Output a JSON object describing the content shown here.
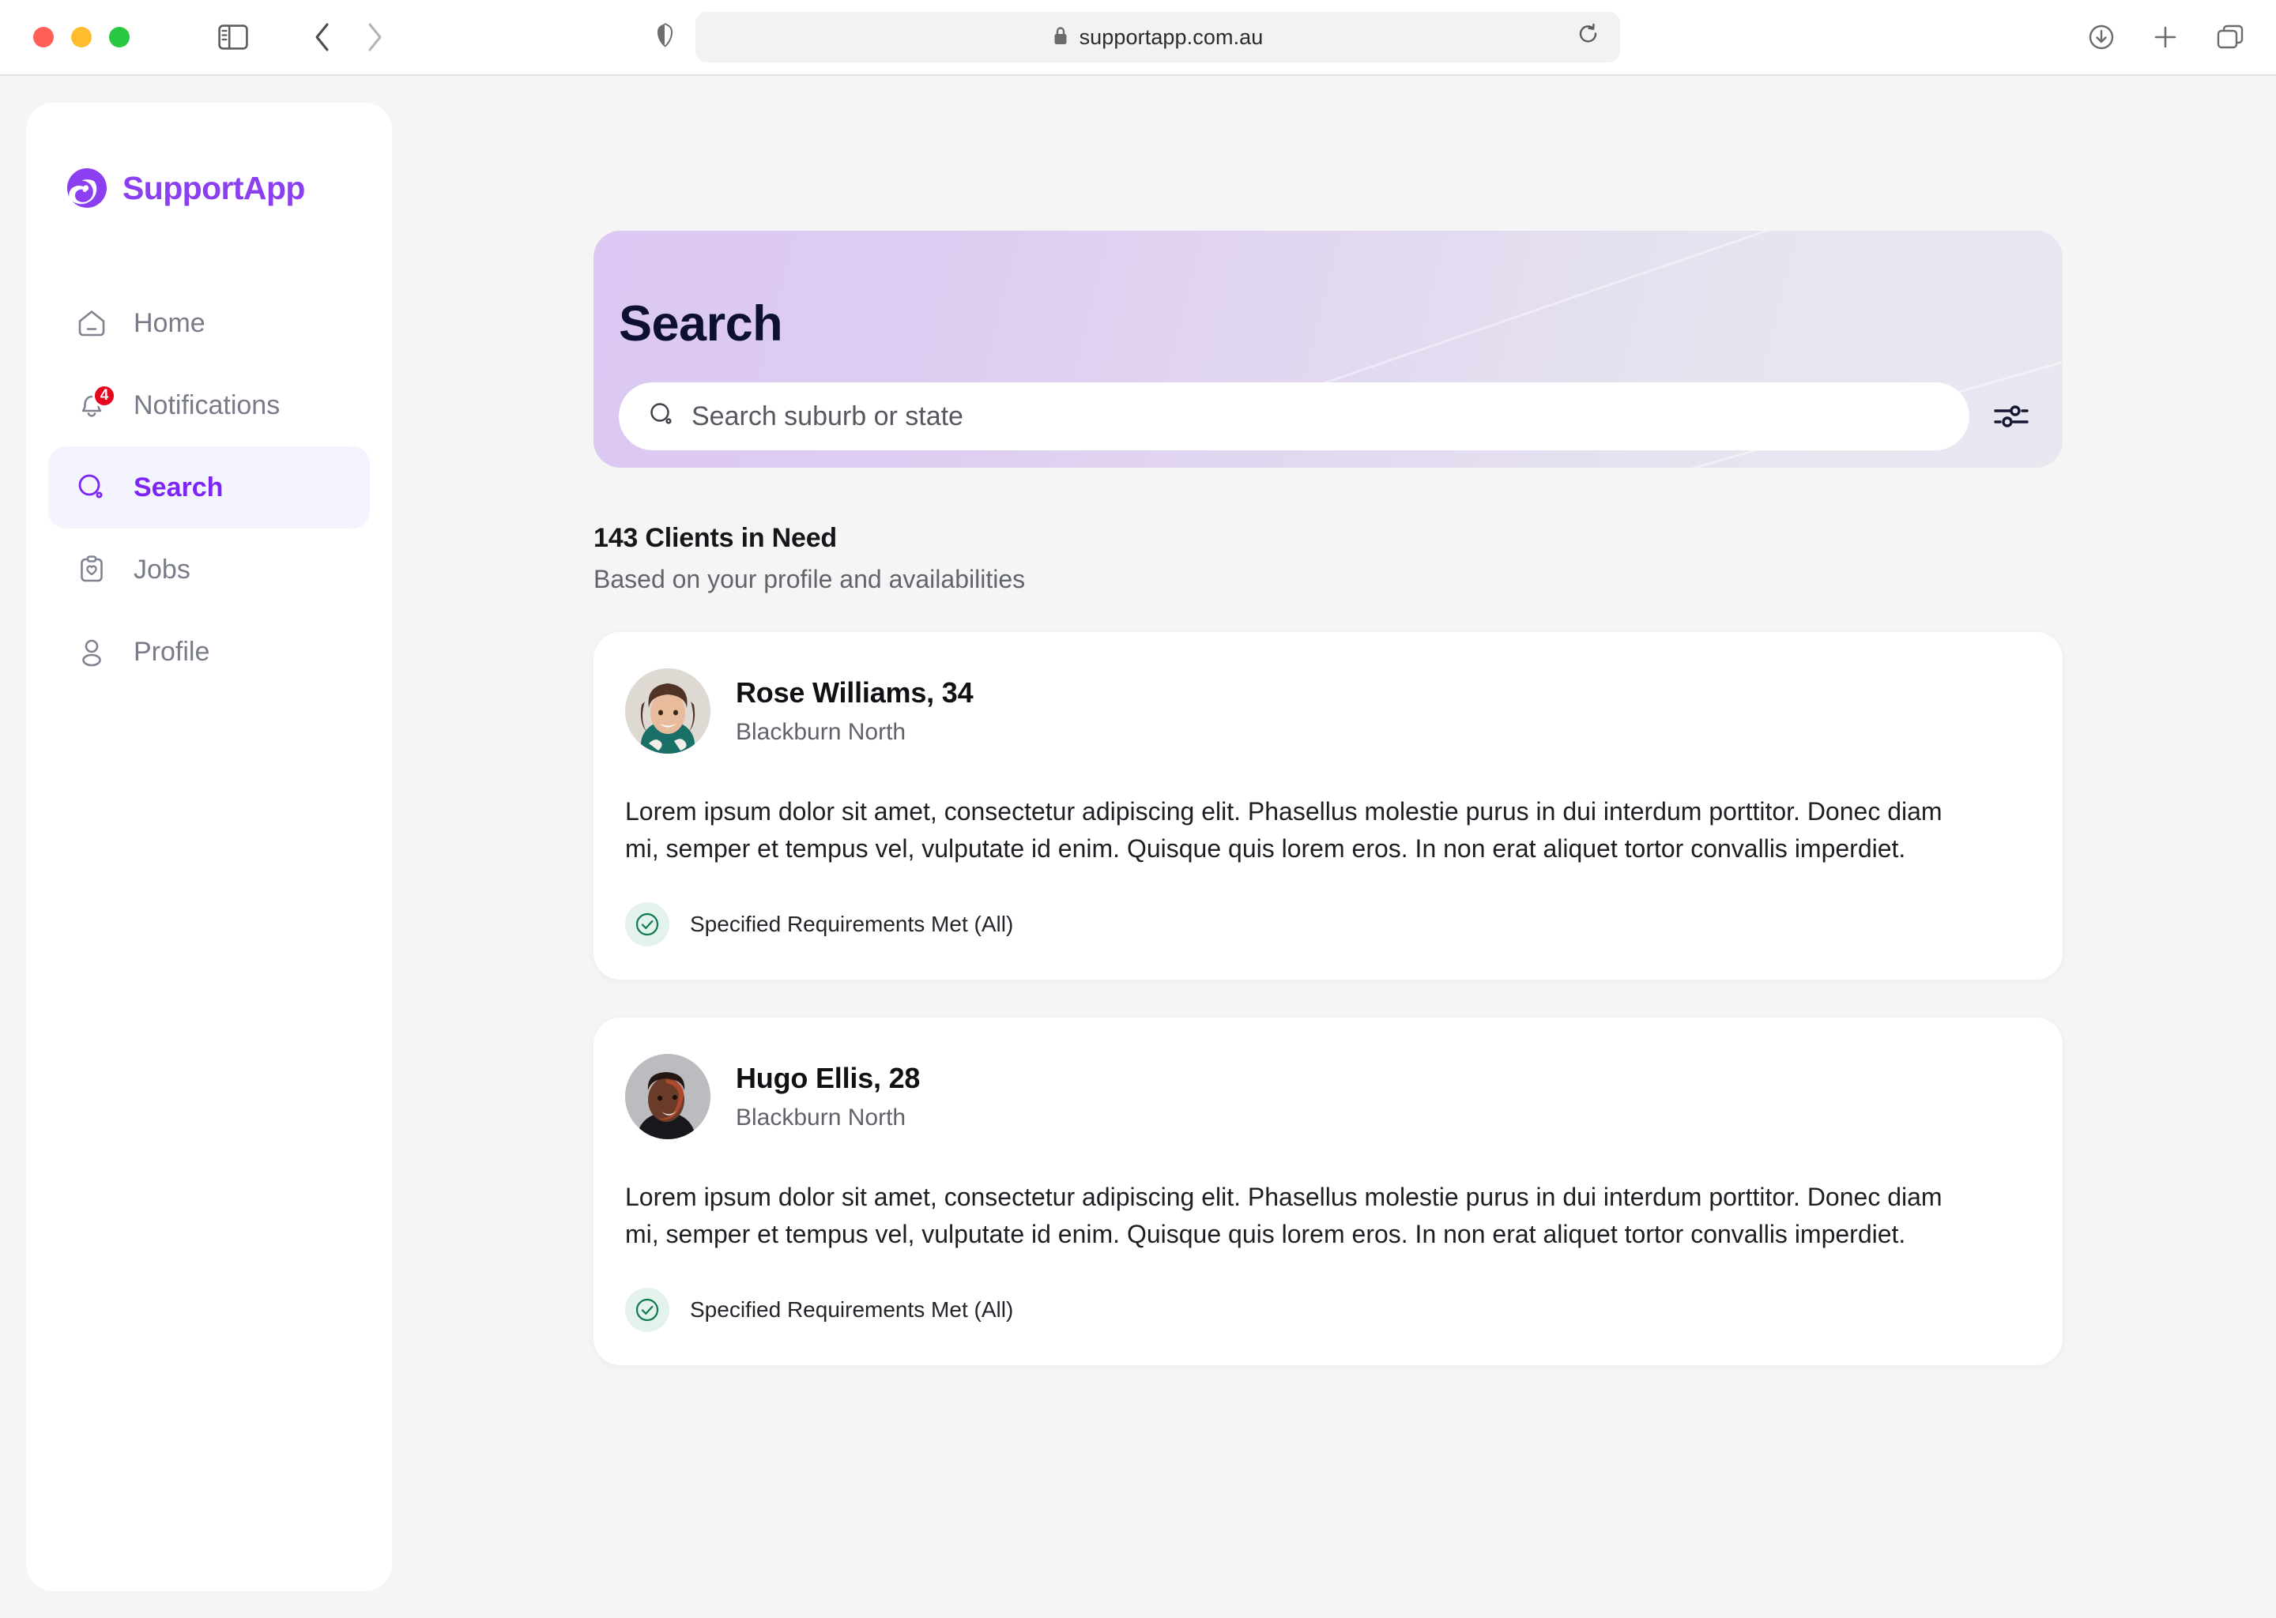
{
  "browser": {
    "url": "supportapp.com.au",
    "secure_icon": "lock-icon",
    "shield_icon": "shield-icon",
    "reload_icon": "reload-icon",
    "sidebar_toggle_icon": "sidebar-toggle-icon",
    "back_icon": "chevron-left-icon",
    "forward_icon": "chevron-right-icon",
    "download_icon": "download-icon",
    "new_tab_icon": "plus-icon",
    "tab_overview_icon": "tab-overview-icon"
  },
  "brand": {
    "name": "SupportApp",
    "logo_icon": "spiral-logo-icon",
    "color": "#8b3ff0"
  },
  "sidebar": {
    "items": [
      {
        "label": "Home",
        "icon": "home-icon",
        "active": false,
        "badge": null
      },
      {
        "label": "Notifications",
        "icon": "bell-icon",
        "active": false,
        "badge": "4"
      },
      {
        "label": "Search",
        "icon": "search-icon",
        "active": true,
        "badge": null
      },
      {
        "label": "Jobs",
        "icon": "clipboard-heart-icon",
        "active": false,
        "badge": null
      },
      {
        "label": "Profile",
        "icon": "person-icon",
        "active": false,
        "badge": null
      }
    ],
    "active_color": "#7c25f5",
    "active_bg": "#f3f4fe",
    "badge_color": "#e5051f"
  },
  "hero": {
    "title": "Search",
    "search_placeholder": "Search suburb or state",
    "search_value": "",
    "search_icon": "search-icon",
    "filter_icon": "filter-sliders-icon",
    "gradient_from": "#dcc8f2",
    "gradient_to": "#e8e7f0"
  },
  "results": {
    "count_label": "143 Clients in Need",
    "subtitle": "Based on your profile and availabilities",
    "clients": [
      {
        "name": "Rose Williams, 34",
        "location": "Blackburn North",
        "avatar": "avatar-rose-williams",
        "description": "Lorem ipsum dolor sit amet, consectetur adipiscing elit. Phasellus molestie purus in dui interdum porttitor. Donec diam mi, semper et tempus vel, vulputate id enim. Quisque quis lorem eros. In non erat aliquet tortor convallis imperdiet.",
        "requirement_label": "Specified Requirements Met (All)",
        "requirement_icon": "check-circle-icon",
        "requirement_color": "#0f7a52"
      },
      {
        "name": "Hugo Ellis, 28",
        "location": "Blackburn North",
        "avatar": "avatar-hugo-ellis",
        "description": "Lorem ipsum dolor sit amet, consectetur adipiscing elit. Phasellus molestie purus in dui interdum porttitor. Donec diam mi, semper et tempus vel, vulputate id enim. Quisque quis lorem eros. In non erat aliquet tortor convallis imperdiet.",
        "requirement_label": "Specified Requirements Met (All)",
        "requirement_icon": "check-circle-icon",
        "requirement_color": "#0f7a52"
      }
    ]
  }
}
